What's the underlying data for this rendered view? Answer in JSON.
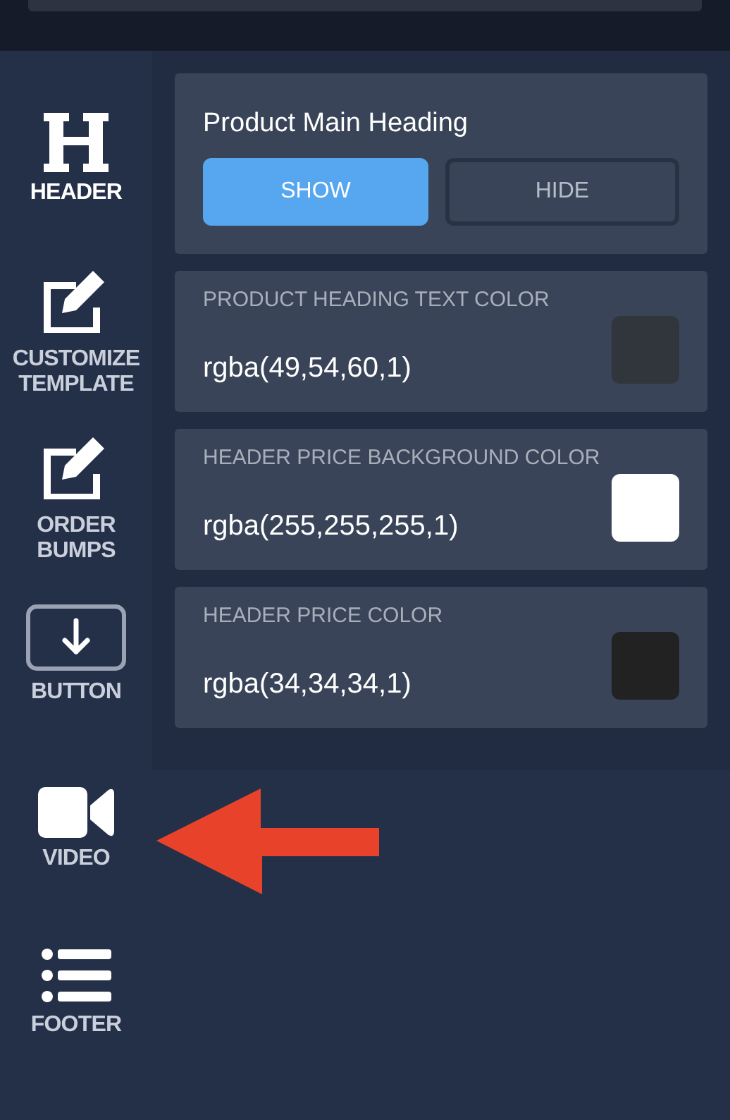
{
  "sidebar": {
    "items": [
      {
        "kind": "heading",
        "label": "HEADER",
        "selected": true
      },
      {
        "kind": "edit",
        "label": "CUSTOMIZE TEMPLATE",
        "selected": false
      },
      {
        "kind": "edit",
        "label": "ORDER BUMPS",
        "selected": false
      },
      {
        "kind": "button",
        "label": "BUTTON",
        "selected": false
      },
      {
        "kind": "video",
        "label": "VIDEO",
        "selected": false
      },
      {
        "kind": "list",
        "label": "FOOTER",
        "selected": false
      }
    ]
  },
  "heading_card": {
    "title": "Product Main Heading",
    "options": [
      {
        "label": "SHOW",
        "selected": true
      },
      {
        "label": "HIDE",
        "selected": false
      }
    ]
  },
  "color_fields": [
    {
      "label": "PRODUCT HEADING TEXT COLOR",
      "value": "rgba(49,54,60,1)",
      "color": "#31363c"
    },
    {
      "label": "HEADER PRICE BACKGROUND COLOR",
      "value": "rgba(255,255,255,1)",
      "color": "#ffffff"
    },
    {
      "label": "HEADER PRICE COLOR",
      "value": "rgba(34,34,34,1)",
      "color": "#222222"
    }
  ]
}
